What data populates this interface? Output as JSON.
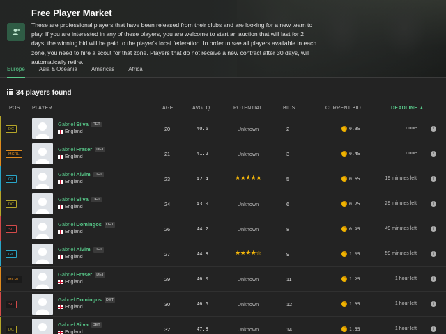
{
  "header": {
    "title": "Free Player Market",
    "description": "These are professional players that have been released from their clubs and are looking for a new team to play. If you are interested in any of these players, you are welcome to start an auction that will last for 2 days, the winning bid will be paid to the player's local federation. In order to see all players available in each zone, you need to hire a scout for that zone. Players that do not receive a new contract after 30 days, will automatically retire.",
    "icon": "add-user-icon"
  },
  "tabs": [
    {
      "label": "Europe",
      "active": true
    },
    {
      "label": "Asia & Oceania",
      "active": false
    },
    {
      "label": "Americas",
      "active": false
    },
    {
      "label": "Africa",
      "active": false
    }
  ],
  "results": {
    "label": "34 players found",
    "icon": "list-icon"
  },
  "columns": {
    "pos": "POS",
    "player": "PLAYER",
    "age": "AGE",
    "avg_q": "AVG. Q.",
    "potential": "POTENTIAL",
    "bids": "BIDS",
    "current_bid": "CURRENT BID",
    "deadline": "DEADLINE ▲"
  },
  "colors": {
    "accent": "#58c98a",
    "DC": "#b5a52a",
    "MCRL": "#e08a1e",
    "GK": "#2aa6c8",
    "SC": "#d24a4a",
    "star": "#f5b70a",
    "coin": "#f0b400"
  },
  "players": [
    {
      "pos": "DC",
      "first": "Gabriel",
      "last": "Silva",
      "club": "DET",
      "country": "England",
      "age": "20",
      "avg_q": "40.6",
      "potential": "Unknown",
      "bids": "2",
      "bid": "0.35",
      "deadline": "done"
    },
    {
      "pos": "MCRL",
      "first": "Gabriel",
      "last": "Fraser",
      "club": "DET",
      "country": "England",
      "age": "21",
      "avg_q": "41.2",
      "potential": "Unknown",
      "bids": "3",
      "bid": "0.45",
      "deadline": "done"
    },
    {
      "pos": "GK",
      "first": "Gabriel",
      "last": "Alvim",
      "club": "DET",
      "country": "England",
      "age": "23",
      "avg_q": "42.4",
      "potential": "★★★★★",
      "bids": "5",
      "bid": "0.65",
      "deadline": "19 minutes left"
    },
    {
      "pos": "DC",
      "first": "Gabriel",
      "last": "Silva",
      "club": "DET",
      "country": "England",
      "age": "24",
      "avg_q": "43.0",
      "potential": "Unknown",
      "bids": "6",
      "bid": "0.75",
      "deadline": "29 minutes left"
    },
    {
      "pos": "SC",
      "first": "Gabriel",
      "last": "Domingos",
      "club": "DET",
      "country": "England",
      "age": "26",
      "avg_q": "44.2",
      "potential": "Unknown",
      "bids": "8",
      "bid": "0.95",
      "deadline": "49 minutes left"
    },
    {
      "pos": "GK",
      "first": "Gabriel",
      "last": "Alvim",
      "club": "DET",
      "country": "England",
      "age": "27",
      "avg_q": "44.8",
      "potential": "★★★★☆",
      "bids": "9",
      "bid": "1.05",
      "deadline": "59 minutes left"
    },
    {
      "pos": "MCRL",
      "first": "Gabriel",
      "last": "Fraser",
      "club": "DET",
      "country": "England",
      "age": "29",
      "avg_q": "46.0",
      "potential": "Unknown",
      "bids": "11",
      "bid": "1.25",
      "deadline": "1 hour left"
    },
    {
      "pos": "SC",
      "first": "Gabriel",
      "last": "Domingos",
      "club": "DET",
      "country": "England",
      "age": "30",
      "avg_q": "46.6",
      "potential": "Unknown",
      "bids": "12",
      "bid": "1.35",
      "deadline": "1 hour left"
    },
    {
      "pos": "DC",
      "first": "Gabriel",
      "last": "Silva",
      "club": "DET",
      "country": "England",
      "age": "32",
      "avg_q": "47.8",
      "potential": "Unknown",
      "bids": "14",
      "bid": "1.55",
      "deadline": "1 hour left"
    }
  ]
}
